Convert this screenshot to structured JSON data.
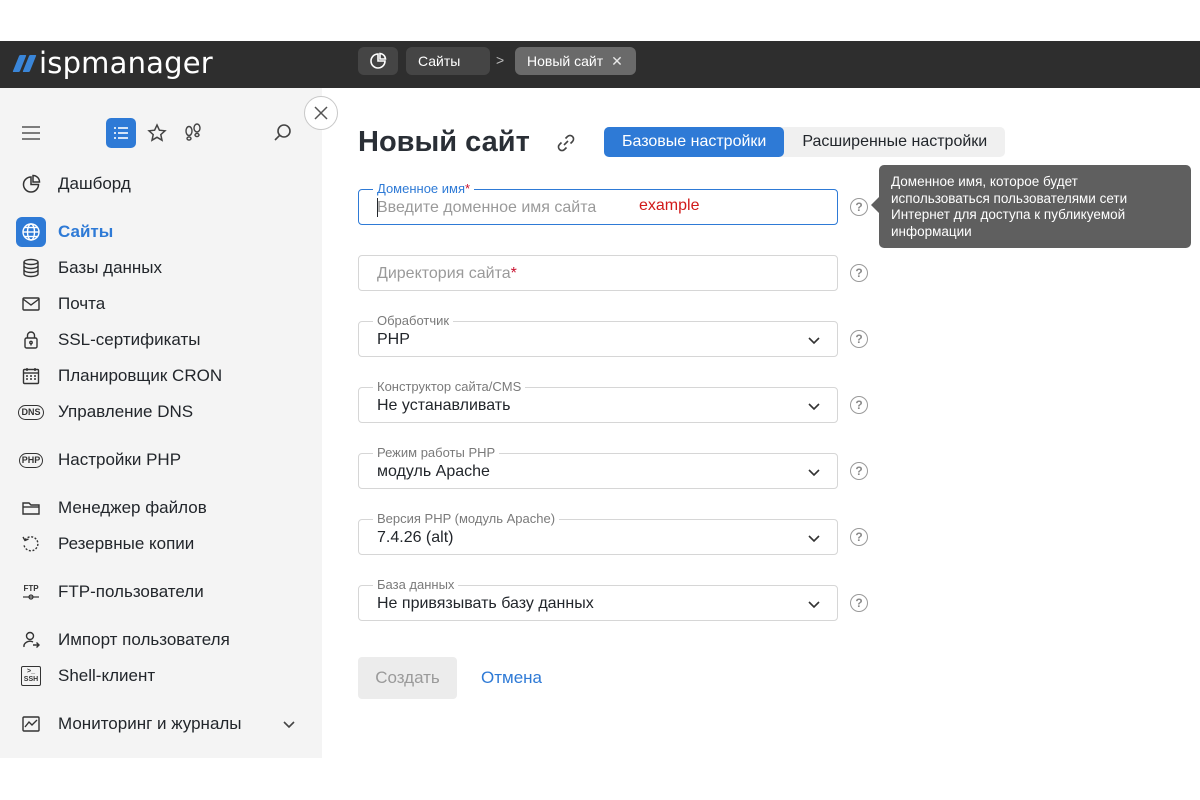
{
  "app": {
    "logo_text": "ispmanager",
    "brand_color": "#2e7ad6"
  },
  "breadcrumbs": [
    {
      "icon": "dashboard-chart-icon"
    },
    {
      "label": "Сайты"
    },
    {
      "label": "Новый сайт",
      "closable": true
    }
  ],
  "breadcrumb_separator": ">",
  "sidebar": {
    "tools": [
      "menu-icon",
      "list-icon",
      "star-icon",
      "footprints-icon",
      "search-icon"
    ],
    "items": [
      {
        "label": "Дашборд",
        "icon": "dashboard-icon"
      },
      {
        "label": "Сайты",
        "icon": "globe-icon",
        "active": true
      },
      {
        "label": "Базы данных",
        "icon": "database-icon"
      },
      {
        "label": "Почта",
        "icon": "mail-icon"
      },
      {
        "label": "SSL-сертификаты",
        "icon": "lock-icon"
      },
      {
        "label": "Планировщик CRON",
        "icon": "calendar-icon"
      },
      {
        "label": "Управление DNS",
        "icon": "dns-icon",
        "icon_text": "DNS"
      },
      {
        "label": "Настройки PHP",
        "icon": "php-icon",
        "icon_text": "PHP"
      },
      {
        "label": "Менеджер файлов",
        "icon": "folder-icon"
      },
      {
        "label": "Резервные копии",
        "icon": "backup-icon"
      },
      {
        "label": "FTP-пользователи",
        "icon": "ftp-icon",
        "icon_text": "FTP"
      },
      {
        "label": "Импорт пользователя",
        "icon": "user-import-icon"
      },
      {
        "label": "Shell-клиент",
        "icon": "shell-icon",
        "icon_text": "SSH"
      },
      {
        "label": "Мониторинг и журналы",
        "icon": "monitoring-icon",
        "expandable": true
      }
    ]
  },
  "page": {
    "title": "Новый сайт",
    "tabs": [
      {
        "label": "Базовые настройки",
        "active": true
      },
      {
        "label": "Расширенные настройки",
        "active": false
      }
    ]
  },
  "form": {
    "domain": {
      "label": "Доменное имя",
      "required_mark": "*",
      "placeholder": "Введите доменное имя сайта",
      "annotation": "example"
    },
    "directory": {
      "placeholder": "Директория сайта",
      "required_mark": "*"
    },
    "handler": {
      "label": "Обработчик",
      "value": "PHP"
    },
    "cms": {
      "label": "Конструктор сайта/CMS",
      "value": "Не устанавливать"
    },
    "php_mode": {
      "label": "Режим работы PHP",
      "value": "модуль Apache"
    },
    "php_version": {
      "label": "Версия PHP (модуль Apache)",
      "value": "7.4.26 (alt)"
    },
    "database": {
      "label": "База данных",
      "value": "Не привязывать базу данных"
    },
    "help_symbol": "?"
  },
  "tooltip": {
    "text": "Доменное имя, которое будет использоваться пользователями сети Интернет для доступа к публикуемой информации"
  },
  "actions": {
    "create": "Создать",
    "cancel": "Отмена"
  }
}
